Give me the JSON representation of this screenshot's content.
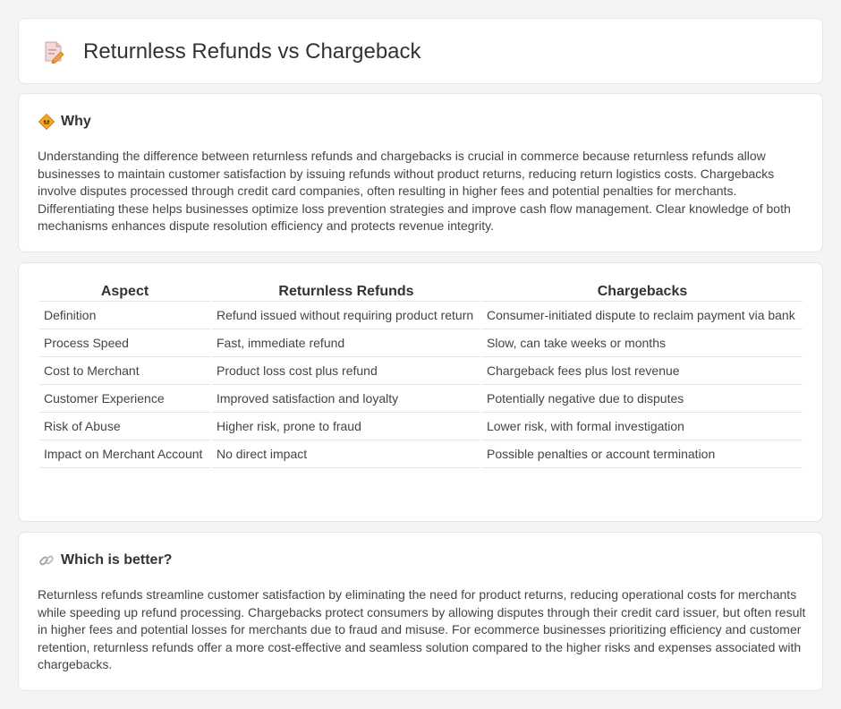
{
  "page": {
    "title": "Returnless Refunds vs Chargeback",
    "icon": "document-pen-icon"
  },
  "why": {
    "icon": "diamond-sign-icon",
    "title": "Why",
    "text": "Understanding the difference between returnless refunds and chargebacks is crucial in commerce because returnless refunds allow businesses to maintain customer satisfaction by issuing refunds without product returns, reducing return logistics costs. Chargebacks involve disputes processed through credit card companies, often resulting in higher fees and potential penalties for merchants. Differentiating these helps businesses optimize loss prevention strategies and improve cash flow management. Clear knowledge of both mechanisms enhances dispute resolution efficiency and protects revenue integrity."
  },
  "comparison": {
    "headers": [
      "Aspect",
      "Returnless Refunds",
      "Chargebacks"
    ],
    "rows": [
      [
        "Definition",
        "Refund issued without requiring product return",
        "Consumer-initiated dispute to reclaim payment via bank"
      ],
      [
        "Process Speed",
        "Fast, immediate refund",
        "Slow, can take weeks or months"
      ],
      [
        "Cost to Merchant",
        "Product loss cost plus refund",
        "Chargeback fees plus lost revenue"
      ],
      [
        "Customer Experience",
        "Improved satisfaction and loyalty",
        "Potentially negative due to disputes"
      ],
      [
        "Risk of Abuse",
        "Higher risk, prone to fraud",
        "Lower risk, with formal investigation"
      ],
      [
        "Impact on Merchant Account",
        "No direct impact",
        "Possible penalties or account termination"
      ]
    ]
  },
  "better": {
    "icon": "link-icon",
    "title": "Which is better?",
    "text": "Returnless refunds streamline customer satisfaction by eliminating the need for product returns, reducing operational costs for merchants while speeding up refund processing. Chargebacks protect consumers by allowing disputes through their credit card issuer, but often result in higher fees and potential losses for merchants due to fraud and misuse. For ecommerce businesses prioritizing efficiency and customer retention, returnless refunds offer a more cost-effective and seamless solution compared to the higher risks and expenses associated with chargebacks."
  },
  "colors": {
    "background": "#f3f4f6",
    "card": "#ffffff",
    "border": "#e3e5e8",
    "accent_orange": "#f5a623",
    "icon_pink": "#e98b8b"
  }
}
